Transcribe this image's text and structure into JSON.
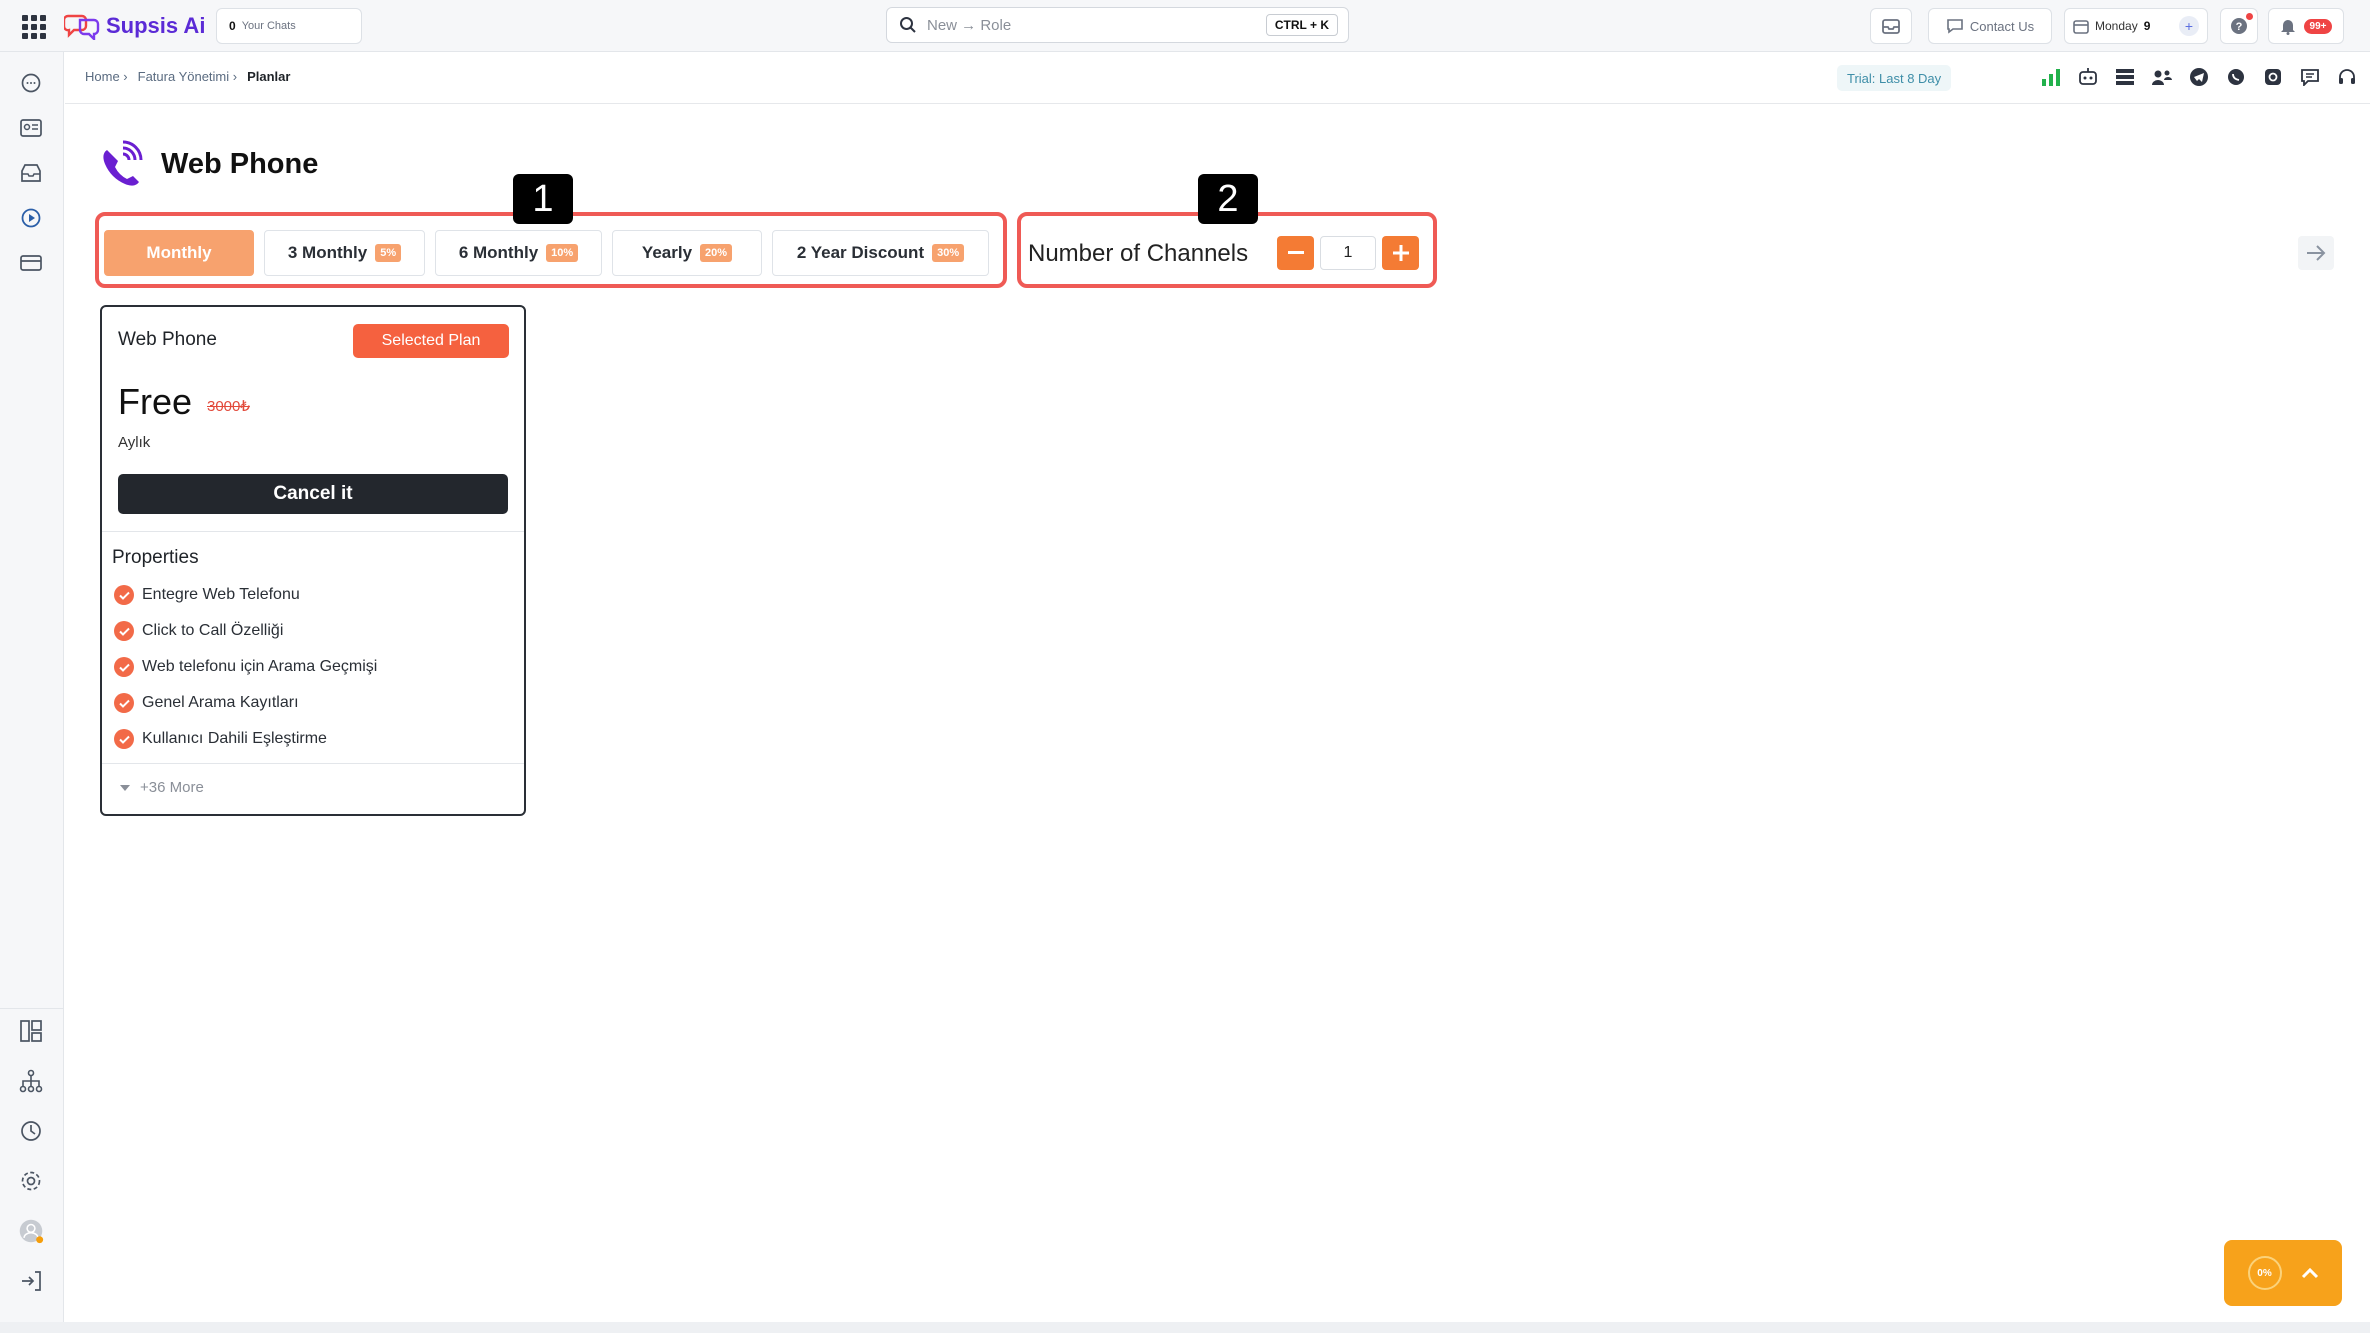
{
  "app": {
    "name": "Supsis Ai",
    "your_chats_count": "0",
    "your_chats_label": "Your Chats",
    "search_placeholder": "New → Role",
    "search_shortcut": "CTRL + K",
    "contact_us": "Contact Us",
    "day_label": "Monday",
    "day_number": "9",
    "notifications_badge": "99+"
  },
  "breadcrumb": {
    "items": [
      "Home ›",
      "Fatura Yönetimi ›"
    ],
    "current": "Planlar"
  },
  "trial_label": "Trial: Last 8 Day",
  "page": {
    "title": "Web Phone"
  },
  "annotations": [
    "1",
    "2"
  ],
  "periods": [
    {
      "label": "Monthly",
      "discount": ""
    },
    {
      "label": "3 Monthly",
      "discount": "5%"
    },
    {
      "label": "6 Monthly",
      "discount": "10%"
    },
    {
      "label": "Yearly",
      "discount": "20%"
    },
    {
      "label": "2 Year Discount",
      "discount": "30%"
    }
  ],
  "channels": {
    "label": "Number of Channels",
    "value": "1"
  },
  "plan_card": {
    "name": "Web Phone",
    "selected_label": "Selected Plan",
    "price": "Free",
    "old_price": "3000₺",
    "period": "Aylık",
    "cancel_label": "Cancel it",
    "properties_title": "Properties",
    "features": [
      "Entegre Web Telefonu",
      "Click to Call Özelliği",
      "Web telefonu için Arama Geçmişi",
      "Genel Arama Kayıtları",
      "Kullanıcı Dahili Eşleştirme"
    ],
    "more_label": "+36 More"
  },
  "progress": {
    "label": "0%"
  },
  "colors": {
    "accent": "#f47b34",
    "brand": "#5b2bd6",
    "annotation": "#ef5a55"
  }
}
